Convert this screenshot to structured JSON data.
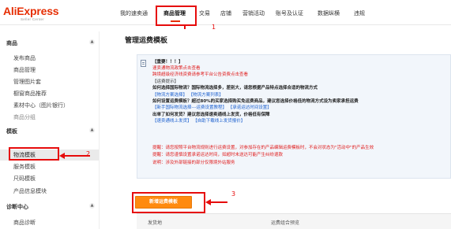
{
  "logo": {
    "brand": "AliExpress",
    "tagline": "Seller Center"
  },
  "nav": [
    {
      "label": "我的速卖通",
      "active": false
    },
    {
      "label": "商品管理",
      "active": true
    },
    {
      "label": "交易",
      "active": false
    },
    {
      "label": "店铺",
      "active": false
    },
    {
      "label": "营销活动",
      "active": false
    },
    {
      "label": "账号及认证",
      "active": false
    },
    {
      "label": "数据纵横",
      "active": false
    },
    {
      "label": "违规",
      "active": false
    }
  ],
  "sidebar": {
    "sections": [
      {
        "title": "商品",
        "toggle": "▲"
      },
      {
        "title": "模板",
        "toggle": "▲"
      },
      {
        "title": "诊断中心",
        "toggle": "▲"
      }
    ],
    "items": [
      "发布商品",
      "商品管理",
      "管理图片套",
      "橱窗商品推荐",
      "素材中心（图片银行）",
      "商品分组",
      "物流模板",
      "服务模板",
      "尺码模板",
      "产品信息模块",
      "商品诊断"
    ]
  },
  "page_title": "管理运费模板",
  "notice": {
    "lines": [
      "【重要！！！】",
      "速卖通物流政策点击查看",
      "跨境超级经济线资费请参考平台公告资费点击查看",
      "【运费提示】",
      "如何选择国际物流？国际物流选择多，差别大，请您根据产品特点选择合适的物流方式",
      "【物流方案选择】 【物流方案列表】",
      "如何设置运费模板？超过80%的买家选择购买免运费商品，建议您选择价格低的物流方式设为卖家承担运费",
      "【新手国际物流选择---运费设置教程】 【承诺运达时间设置】",
      "出单了如何发货？建议您选择速卖通线上发货，价格低有保障",
      "【速卖通线上发货】 【自助下载线上发货报价】",
      "提醒：请您按照平台物流规则进行运费设置，对参加存在的产品编辑运费模板时，不会对状态为\"活动中\"的产品生效",
      "提醒：请您谨慎设置承诺运达时间，如超时未送达可能产生纠纷退款",
      "说明：涉及外部链接的部分仅限境外站服务"
    ]
  },
  "add_button": "新增运费模板",
  "table": {
    "columns": [
      "发货地",
      "运费组合预览"
    ]
  },
  "annotations": {
    "one": "1",
    "two": "2",
    "three": "3"
  }
}
